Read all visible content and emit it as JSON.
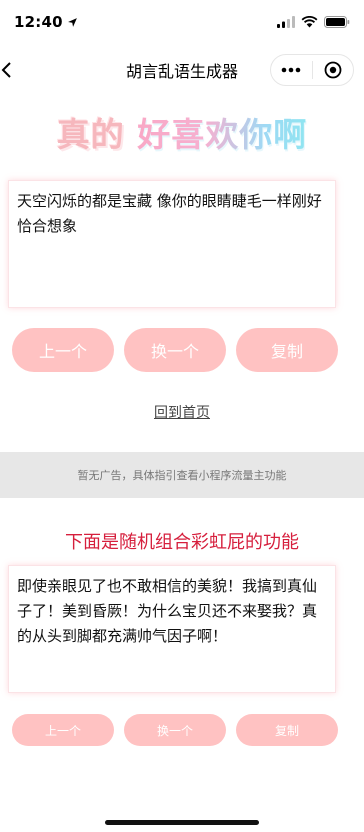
{
  "status_bar": {
    "time": "12:40",
    "icons": [
      "location-arrow-icon",
      "signal-icon",
      "wifi-icon",
      "battery-icon"
    ]
  },
  "nav": {
    "title": "胡言乱语生成器",
    "back_icon": "chevron-left-icon",
    "more_icon": "more-dots-icon",
    "close_icon": "target-close-icon"
  },
  "hero": {
    "part1": "真的",
    "part2": "好喜欢你啊"
  },
  "card1": {
    "text": "天空闪烁的都是宝藏 像你的眼睛睫毛一样刚好恰合想象"
  },
  "buttons1": {
    "prev": "上一个",
    "next": "换一个",
    "copy": "复制"
  },
  "home_link": "回到首页",
  "ad_text": "暂无广告，具体指引查看小程序流量主功能",
  "section_title": "下面是随机组合彩虹屁的功能",
  "card2": {
    "text": "即使亲眼见了也不敢相信的美貌！我搞到真仙子了！美到昏厥！为什么宝贝还不来娶我？真的从头到脚都充满帅气因子啊！"
  },
  "buttons2": {
    "prev": "上一个",
    "next": "换一个",
    "copy": "复制"
  },
  "colors": {
    "button_bg": "#ffc2c2",
    "section_title": "#d61f3d",
    "ad_bg": "#e7e7e7"
  }
}
